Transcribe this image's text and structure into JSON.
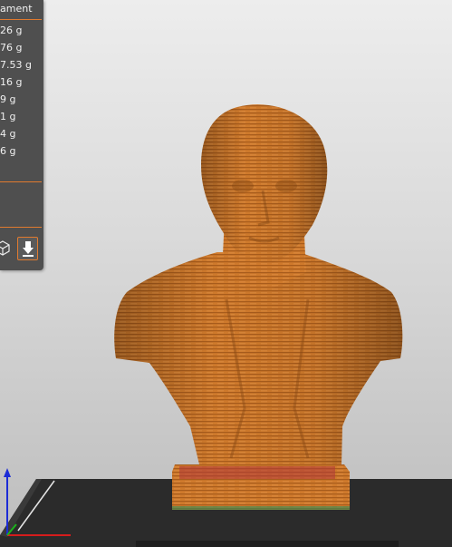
{
  "stats": {
    "header_label": "ament",
    "weights": [
      "26 g",
      "76 g",
      "7.53 g",
      "16 g",
      "9 g",
      "1 g",
      "4 g",
      "6 g"
    ]
  },
  "toolbar": {
    "view_cube_icon": "cube-outline-icon",
    "export_icon": "export-download-icon"
  },
  "colors": {
    "filament": "#cf7a2c",
    "panel_bg": "#4f4f4f",
    "accent": "#e07a2f",
    "bed": "#2b2b2b"
  }
}
